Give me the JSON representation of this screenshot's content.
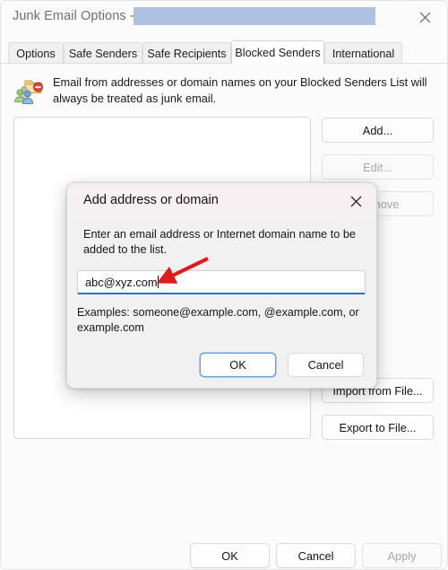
{
  "window": {
    "title": "Junk Email Options - ",
    "title_redacted": true,
    "close_icon": "close-icon"
  },
  "tabs": [
    {
      "label": "Options",
      "active": false
    },
    {
      "label": "Safe Senders",
      "active": false
    },
    {
      "label": "Safe Recipients",
      "active": false
    },
    {
      "label": "Blocked Senders",
      "active": true
    },
    {
      "label": "International",
      "active": false
    }
  ],
  "panel": {
    "info_icon": "blocked-senders-icon",
    "info_text": "Email from addresses or domain names on your Blocked Senders List will always be treated as junk email.",
    "list_items": [],
    "buttons": [
      {
        "id": "add",
        "label": "Add...",
        "enabled": true
      },
      {
        "id": "edit",
        "label": "Edit...",
        "enabled": false
      },
      {
        "id": "remove",
        "label": "Remove",
        "enabled": false
      },
      {
        "id": "import",
        "label": "Import from File...",
        "enabled": true
      },
      {
        "id": "export",
        "label": "Export to File...",
        "enabled": true
      }
    ]
  },
  "footer": {
    "ok_label": "OK",
    "cancel_label": "Cancel",
    "apply_label": "Apply",
    "apply_enabled": false
  },
  "dialog": {
    "title": "Add address or domain",
    "close_icon": "close-icon",
    "prompt": "Enter an email address or Internet domain name to be added to the list.",
    "input_value": "abc@xyz.com",
    "input_placeholder": "",
    "examples": "Examples: someone@example.com, @example.com, or example.com",
    "ok_label": "OK",
    "cancel_label": "Cancel",
    "ok_is_default": true
  },
  "annotation": {
    "arrow_color": "#e01b1b",
    "points_to": "address-input-field"
  },
  "colors": {
    "accent_blue": "#2a6fd2",
    "redaction_blue": "#aec1e3",
    "default_button_border": "#6ba2d6",
    "window_background": "#fbfbfb",
    "dialog_background": "#f1f1f1",
    "dialog_header": "#f7eff2",
    "annotation_red": "#e01b1b"
  }
}
